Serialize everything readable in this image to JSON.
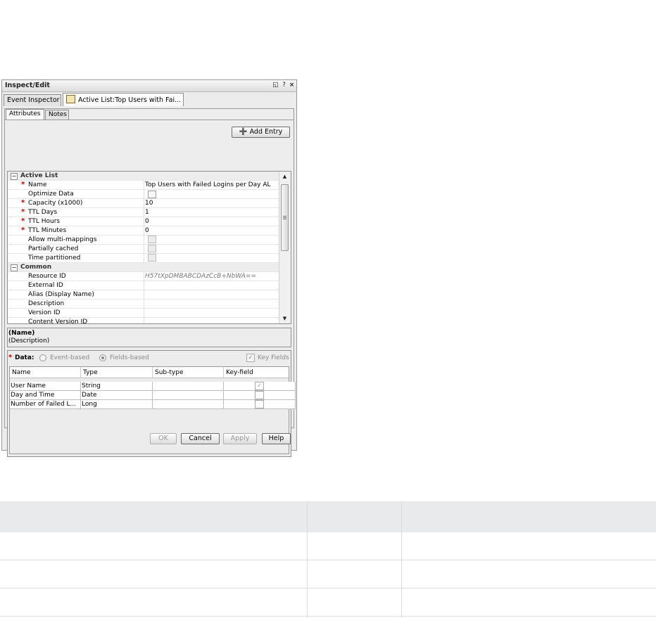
{
  "window": {
    "title": "Inspect/Edit",
    "controls": [
      "◱",
      "?",
      "×"
    ]
  },
  "doc_tabs": [
    {
      "label": "Event Inspector"
    },
    {
      "label": "Active List:Top Users with Fai..."
    }
  ],
  "sub_tabs": [
    {
      "label": "Attributes"
    },
    {
      "label": "Notes"
    }
  ],
  "toolbar": {
    "add_entry": "Add Entry"
  },
  "grid": {
    "categories": {
      "active_list": "Active List",
      "common": "Common"
    },
    "rows": [
      {
        "key": "Name",
        "value": "Top Users with Failed Logins per Day AL"
      },
      {
        "key": "Optimize Data",
        "value": ""
      },
      {
        "key": "Capacity (x1000)",
        "value": "10"
      },
      {
        "key": "TTL Days",
        "value": "1"
      },
      {
        "key": "TTL Hours",
        "value": "0"
      },
      {
        "key": "TTL Minutes",
        "value": "0"
      },
      {
        "key": "Allow multi-mappings",
        "value": ""
      },
      {
        "key": "Partially cached",
        "value": ""
      },
      {
        "key": "Time partitioned",
        "value": ""
      },
      {
        "key": "Resource ID",
        "value": "H57tXpDMBABCDAzCcB+NbWA=="
      },
      {
        "key": "External ID",
        "value": ""
      },
      {
        "key": "Alias (Display Name)",
        "value": ""
      },
      {
        "key": "Description",
        "value": ""
      },
      {
        "key": "Version ID",
        "value": ""
      },
      {
        "key": "Content Version ID",
        "value": ""
      }
    ],
    "required_mark": "*"
  },
  "description_box": {
    "title": "(Name)",
    "text": "(Description)"
  },
  "data_section": {
    "label": "Data:",
    "required_mark": "*",
    "event_based": "Event-based",
    "fields_based": "Fields-based",
    "key_fields": "Key Fields",
    "columns": [
      "Name",
      "Type",
      "Sub-type",
      "Key-field"
    ],
    "rows": [
      {
        "name": "User Name",
        "type": "String",
        "subtype": "",
        "key": true
      },
      {
        "name": "Day and Time",
        "type": "Date",
        "subtype": "",
        "key": false
      },
      {
        "name": "Number of Failed L...",
        "type": "Long",
        "subtype": "",
        "key": false
      }
    ]
  },
  "footer": {
    "ok": "OK",
    "cancel": "Cancel",
    "apply": "Apply",
    "help": "Help"
  },
  "colors": {
    "required": "#c00000",
    "table_header": "#e8eaec"
  }
}
